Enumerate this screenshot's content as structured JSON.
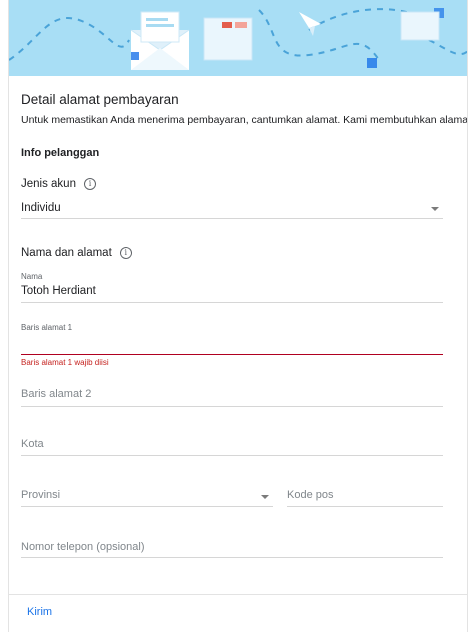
{
  "header": {
    "title": "Detail alamat pembayaran",
    "description": "Untuk memastikan Anda menerima pembayaran, cantumkan alamat. Kami membutuhkan alamat ini"
  },
  "customer_info": {
    "heading": "Info pelanggan",
    "account_type_label": "Jenis akun",
    "account_type_value": "Individu"
  },
  "name_address": {
    "heading": "Nama dan alamat",
    "name_label": "Nama",
    "name_value": "Totoh Herdiant",
    "address1_label": "Baris alamat 1",
    "address1_error": "Baris alamat 1 wajib diisi",
    "address2_placeholder": "Baris alamat 2",
    "city_placeholder": "Kota",
    "province_placeholder": "Provinsi",
    "postal_placeholder": "Kode pos",
    "phone_placeholder": "Nomor telepon (opsional)"
  },
  "footer": {
    "submit_label": "Kirim"
  },
  "colors": {
    "banner": "#a8def5",
    "accent": "#1a73e8",
    "error": "#b00020"
  }
}
